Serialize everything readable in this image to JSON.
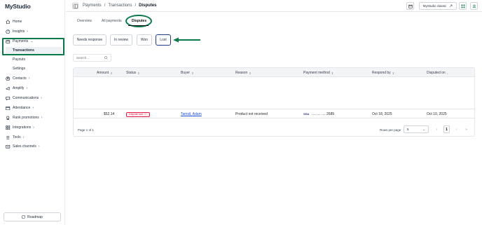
{
  "app": {
    "logo": "MyStudio"
  },
  "sidebar": {
    "items": [
      {
        "label": "Home",
        "icon": "home-icon"
      },
      {
        "label": "Insights",
        "icon": "insights-icon"
      },
      {
        "label": "Payments",
        "icon": "wallet-icon"
      },
      {
        "label": "Contacts",
        "icon": "contacts-icon"
      },
      {
        "label": "Amplify",
        "icon": "amplify-icon"
      },
      {
        "label": "Communications",
        "icon": "chat-icon"
      },
      {
        "label": "Attendance",
        "icon": "attendance-icon"
      },
      {
        "label": "Rank promotions",
        "icon": "rank-icon"
      },
      {
        "label": "Integrations",
        "icon": "integrations-icon"
      },
      {
        "label": "Tools",
        "icon": "tools-icon"
      },
      {
        "label": "Sales channels",
        "icon": "sales-icon"
      }
    ],
    "payments_sub": [
      "Transactions",
      "Payouts",
      "Settings"
    ],
    "roadmap": "Roadmap"
  },
  "topbar": {
    "breadcrumb": [
      "Payments",
      "/",
      "Transactions",
      "/",
      "Disputes"
    ],
    "classic_label": "MyStudio classic"
  },
  "tabs": [
    "Overview",
    "All payments",
    "Disputes"
  ],
  "filters": [
    "Needs response",
    "In review",
    "Won",
    "Lost"
  ],
  "search": {
    "placeholder": "Search..."
  },
  "table": {
    "headers": [
      "Amount",
      "Status",
      "Buyer",
      "Reason",
      "Payment method",
      "Respond by",
      "Disputed on"
    ],
    "row": {
      "amount": "$52.14",
      "status": "Dispute lost",
      "buyer": "Tamsil, Adam",
      "reason": "Product not received",
      "card_brand": "VISA",
      "card_masked": ".... .... .... 2685",
      "respond_by": "Oct 18, 2025",
      "disputed_on": "Oct 10, 2025"
    },
    "page_label": "Page 1 of 1",
    "rows_per_page_label": "Rows per page",
    "rows_per_page": "5",
    "current_page": "1"
  },
  "colors": {
    "highlight": "#0b7a4b",
    "status_lost": "#e11d48",
    "link": "#1d4ed8"
  }
}
